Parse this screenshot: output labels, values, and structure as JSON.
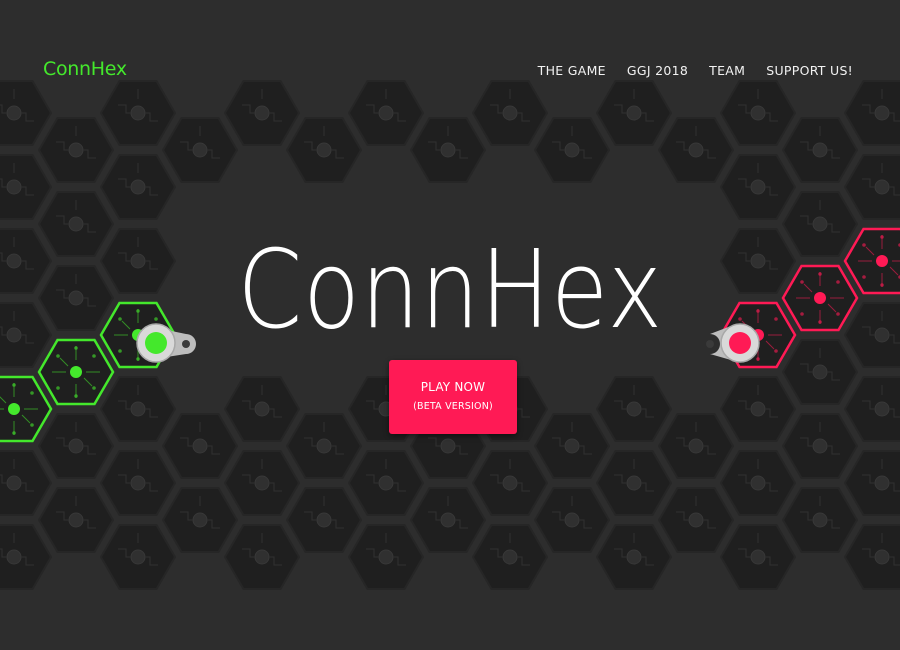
{
  "header": {
    "logo_text": "ConnHex",
    "nav": [
      {
        "label": "THE GAME"
      },
      {
        "label": "GGJ 2018"
      },
      {
        "label": "TEAM"
      },
      {
        "label": "SUPPORT US!"
      }
    ]
  },
  "hero": {
    "title": "ConnHex",
    "play_button": {
      "label": "PLAY NOW",
      "sublabel": "(BETA VERSION)"
    }
  },
  "colors": {
    "background": "#2d2d2d",
    "hex_tile": "#1f1f1f",
    "player_green": "#44e82c",
    "player_red": "#ff1a55",
    "text": "#ffffff"
  }
}
